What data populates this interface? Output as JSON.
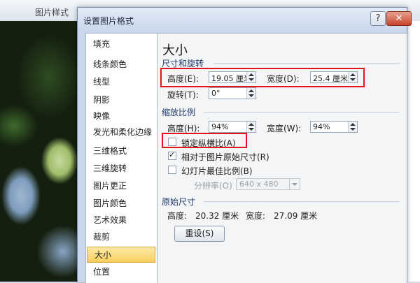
{
  "background": {
    "ribbon_label": "图片样式"
  },
  "dialog": {
    "title": "设置图片格式",
    "help_label": "?",
    "close_label": "✕"
  },
  "nav": {
    "items": [
      {
        "label": "填充"
      },
      {
        "label": "线条颜色"
      },
      {
        "label": "线型"
      },
      {
        "label": "阴影"
      },
      {
        "label": "映像"
      },
      {
        "label": "发光和柔化边缘"
      },
      {
        "label": "三维格式"
      },
      {
        "label": "三维旋转"
      },
      {
        "label": "图片更正"
      },
      {
        "label": "图片颜色"
      },
      {
        "label": "艺术效果"
      },
      {
        "label": "裁剪"
      },
      {
        "label": "大小"
      },
      {
        "label": "位置"
      }
    ],
    "active": "大小"
  },
  "panel": {
    "heading": "大小",
    "size_rotate": {
      "section": "尺寸和旋转",
      "height_label": "高度(E):",
      "height_value": "19.05 厘米",
      "width_label": "宽度(D):",
      "width_value": "25.4 厘米",
      "rotation_label": "旋转(T):",
      "rotation_value": "0°"
    },
    "scale": {
      "section": "缩放比例",
      "height_label": "高度(H):",
      "height_value": "94%",
      "width_label": "宽度(W):",
      "width_value": "94%",
      "lock_aspect_label": "锁定纵横比(A)",
      "lock_aspect_checked": false,
      "relative_label": "相对于图片原始尺寸(R)",
      "relative_checked": true,
      "slideshow_label": "幻灯片最佳比例(B)",
      "slideshow_checked": false,
      "resolution_label": "分辨率(O)",
      "resolution_value": "640 x 480"
    },
    "original": {
      "section": "原始尺寸",
      "height_label": "高度:",
      "height_value": "20.32 厘米",
      "width_label": "宽度:",
      "width_value": "27.09 厘米",
      "reset_label": "重设(S)"
    }
  },
  "colors": {
    "highlight": "#e3141c",
    "active_nav": "#f7cf5d"
  }
}
